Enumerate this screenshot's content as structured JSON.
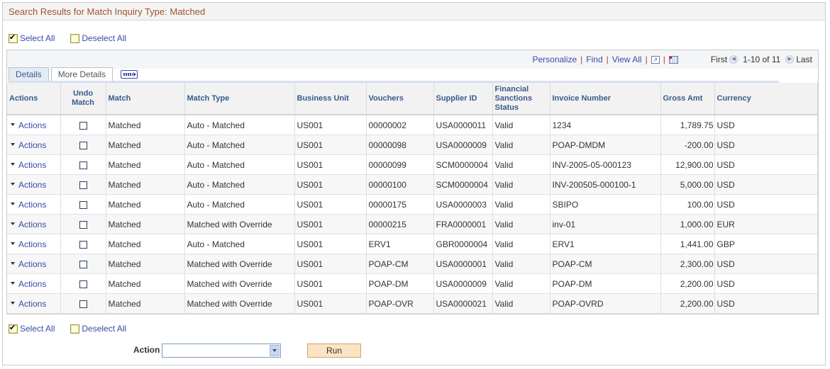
{
  "page": {
    "title": "Search Results for Match Inquiry Type: Matched"
  },
  "selection": {
    "select_all": "Select All",
    "deselect_all": "Deselect All"
  },
  "grid_nav": {
    "personalize": "Personalize",
    "find": "Find",
    "view_all": "View All",
    "first": "First",
    "range": "1-10 of 11",
    "last": "Last",
    "icons": [
      "zoom-grid-icon",
      "download-spreadsheet-icon",
      "previous-icon",
      "next-icon"
    ]
  },
  "tabs": [
    {
      "label": "Details",
      "active": true
    },
    {
      "label": "More Details",
      "active": false
    }
  ],
  "columns": [
    "Actions",
    "Undo Match",
    "Match",
    "Match Type",
    "Business Unit",
    "Vouchers",
    "Supplier ID",
    "Financial Sanctions Status",
    "Invoice Number",
    "Gross Amt",
    "Currency"
  ],
  "rows": [
    {
      "action": "Actions",
      "match": "Matched",
      "match_type": "Auto - Matched",
      "bu": "US001",
      "voucher": "00000002",
      "supplier": "USA0000011",
      "sanctions": "Valid",
      "invoice": "1234",
      "gross": "1,789.75",
      "currency": "USD"
    },
    {
      "action": "Actions",
      "match": "Matched",
      "match_type": "Auto - Matched",
      "bu": "US001",
      "voucher": "00000098",
      "supplier": "USA0000009",
      "sanctions": "Valid",
      "invoice": "POAP-DMDM",
      "gross": "-200.00",
      "currency": "USD"
    },
    {
      "action": "Actions",
      "match": "Matched",
      "match_type": "Auto - Matched",
      "bu": "US001",
      "voucher": "00000099",
      "supplier": "SCM0000004",
      "sanctions": "Valid",
      "invoice": "INV-2005-05-000123",
      "gross": "12,900.00",
      "currency": "USD"
    },
    {
      "action": "Actions",
      "match": "Matched",
      "match_type": "Auto - Matched",
      "bu": "US001",
      "voucher": "00000100",
      "supplier": "SCM0000004",
      "sanctions": "Valid",
      "invoice": "INV-200505-000100-1",
      "gross": "5,000.00",
      "currency": "USD"
    },
    {
      "action": "Actions",
      "match": "Matched",
      "match_type": "Auto - Matched",
      "bu": "US001",
      "voucher": "00000175",
      "supplier": "USA0000003",
      "sanctions": "Valid",
      "invoice": "SBIPO",
      "gross": "100.00",
      "currency": "USD"
    },
    {
      "action": "Actions",
      "match": "Matched",
      "match_type": "Matched with Override",
      "bu": "US001",
      "voucher": "00000215",
      "supplier": "FRA0000001",
      "sanctions": "Valid",
      "invoice": "inv-01",
      "gross": "1,000.00",
      "currency": "EUR"
    },
    {
      "action": "Actions",
      "match": "Matched",
      "match_type": "Auto - Matched",
      "bu": "US001",
      "voucher": "ERV1",
      "supplier": "GBR0000004",
      "sanctions": "Valid",
      "invoice": "ERV1",
      "gross": "1,441.00",
      "currency": "GBP"
    },
    {
      "action": "Actions",
      "match": "Matched",
      "match_type": "Matched with Override",
      "bu": "US001",
      "voucher": "POAP-CM",
      "supplier": "USA0000001",
      "sanctions": "Valid",
      "invoice": "POAP-CM",
      "gross": "2,300.00",
      "currency": "USD"
    },
    {
      "action": "Actions",
      "match": "Matched",
      "match_type": "Matched with Override",
      "bu": "US001",
      "voucher": "POAP-DM",
      "supplier": "USA0000009",
      "sanctions": "Valid",
      "invoice": "POAP-DM",
      "gross": "2,200.00",
      "currency": "USD"
    },
    {
      "action": "Actions",
      "match": "Matched",
      "match_type": "Matched with Override",
      "bu": "US001",
      "voucher": "POAP-OVR",
      "supplier": "USA0000021",
      "sanctions": "Valid",
      "invoice": "POAP-OVRD",
      "gross": "2,200.00",
      "currency": "USD"
    }
  ],
  "footer": {
    "action_label": "Action",
    "action_value": "",
    "run_label": "Run"
  },
  "colors": {
    "title": "#a0522d",
    "link": "#3a4aa6",
    "header_text": "#3a5a8c",
    "run_button": "#fbe4c4"
  }
}
